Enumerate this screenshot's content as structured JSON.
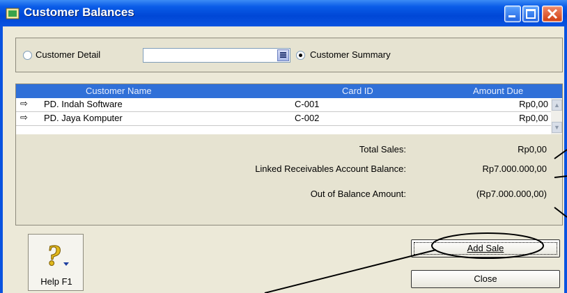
{
  "window": {
    "title": "Customer Balances"
  },
  "options": {
    "customer_detail_label": "Customer Detail",
    "customer_detail_mnemonic": "D",
    "customer_summary_label": "Customer Summary",
    "customer_summary_mnemonic": "u",
    "selected": "Customer Summary",
    "combo_value": ""
  },
  "table": {
    "columns": [
      "Customer Name",
      "Card ID",
      "Amount Due"
    ],
    "rows": [
      {
        "name": "PD. Indah Software",
        "card_id": "C-001",
        "amount_due": "Rp0,00"
      },
      {
        "name": "PD. Jaya Komputer",
        "card_id": "C-002",
        "amount_due": "Rp0,00"
      }
    ]
  },
  "totals": {
    "total_sales_label": "Total Sales:",
    "total_sales_value": "Rp0,00",
    "linked_label": "Linked Receivables Account Balance:",
    "linked_value": "Rp7.000.000,00",
    "oob_label": "Out of Balance Amount:",
    "oob_value": "(Rp7.000.000,00)"
  },
  "buttons": {
    "help_label": "Help F1",
    "add_sale_label": "Add Sale",
    "close_label": "Close"
  },
  "colors": {
    "title_bar": "#0a53e0",
    "list_header": "#3070d8",
    "dialog_bg": "#ece9d8"
  },
  "icons": [
    "app-icon",
    "minimize-icon",
    "maximize-icon",
    "close-icon",
    "dropdown-icon",
    "row-arrow-icon",
    "help-icon",
    "scroll-up-icon",
    "scroll-down-icon"
  ]
}
